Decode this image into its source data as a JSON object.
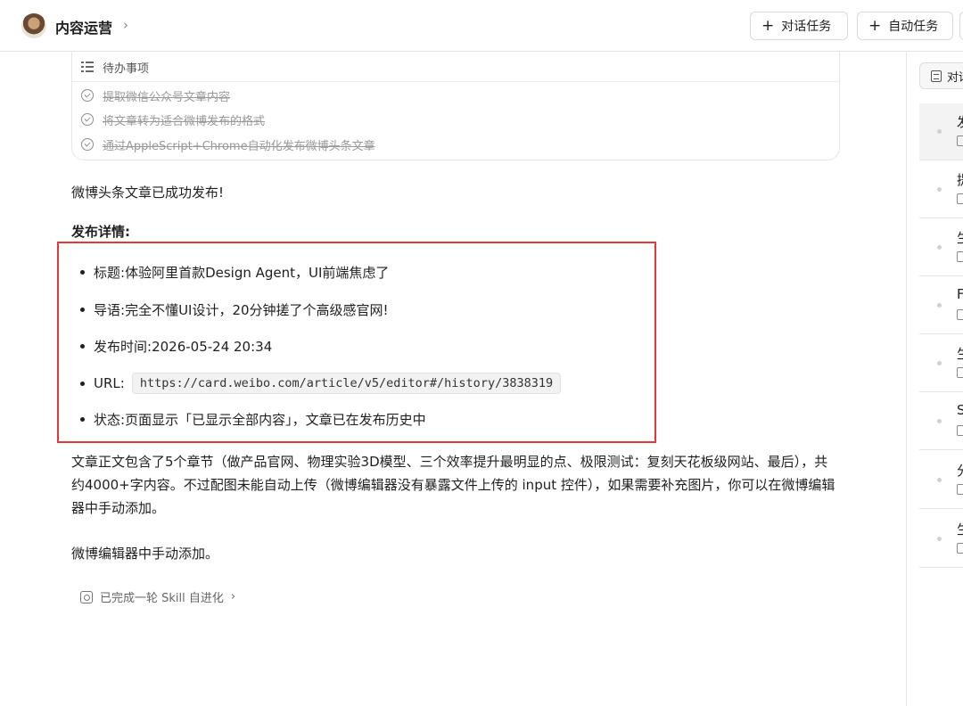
{
  "header": {
    "title": "内容运营",
    "chevron": "›",
    "chat_task_label": "对话任务",
    "auto_task_label": "自动任务",
    "plus_glyph": "+"
  },
  "todo": {
    "title": "待办事项",
    "items": [
      "提取微信公众号文章内容",
      "将文章转为适合微博发布的格式",
      "通过AppleScript+Chrome自动化发布微博头条文章"
    ]
  },
  "message": {
    "success_line": "微博头条文章已成功发布!",
    "details_heading": "发布详情:",
    "details": {
      "title_label": "标题:",
      "title_value": "体验阿里首款Design Agent，UI前端焦虑了",
      "lead_label": "导语:",
      "lead_value": "完全不懂UI设计，20分钟搓了个高级感官网!",
      "time_label": "发布时间:",
      "time_value": "2026-05-24 20:34",
      "url_label": "URL:",
      "url_value": "https://card.weibo.com/article/v5/editor#/history/3838319",
      "status_label": "状态:",
      "status_value": "页面显示「已显示全部内容」，文章已在发布历史中"
    },
    "body_paragraph": "文章正文包含了5个章节（做产品官网、物理实验3D模型、三个效率提升最明显的点、极限测试：复刻天花板级网站、最后），共约4000+字内容。不过配图未能自动上传（微博编辑器没有暴露文件上传的 input 控件），如果需要补充图片，你可以在微博编辑器中手动添加。",
    "tail_line": "微博编辑器中手动添加。",
    "skill_status": "已完成一轮 Skill 自进化",
    "skill_chevron": "›"
  },
  "sidebar": {
    "tab_label": "对话",
    "items": [
      "发",
      "提",
      "生",
      "F",
      "生",
      "S",
      "分",
      "生"
    ]
  },
  "colors": {
    "highlight_border": "#e53935",
    "divider": "#e6e6e6",
    "muted_text": "#9a9a9a"
  }
}
